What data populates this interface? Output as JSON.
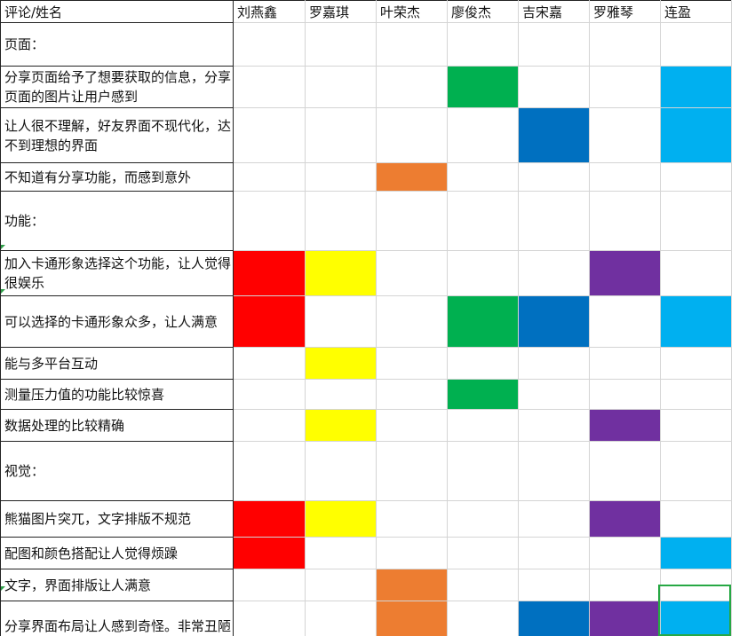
{
  "header": {
    "corner_label": "评论/姓名",
    "names": [
      "刘燕鑫",
      "罗嘉琪",
      "叶荣杰",
      "廖俊杰",
      "吉宋嘉",
      "罗雅琴",
      "连盈"
    ]
  },
  "colors": {
    "red": "#ff0000",
    "yellow": "#ffff00",
    "orange": "#ed7d31",
    "green": "#00b050",
    "blue": "#0070c0",
    "purple": "#7030a0",
    "cyan": "#00b0f0",
    "grid": "#d4d4d4",
    "selection": "#27a844"
  },
  "rows": [
    {
      "text": "页面：",
      "marks": [
        "",
        "",
        "",
        "",
        "",
        "",
        ""
      ]
    },
    {
      "text": "分享页面给予了想要获取的信息，分享页面的图片让用户感到",
      "marks": [
        "",
        "",
        "",
        "green",
        "",
        "",
        "cyan"
      ]
    },
    {
      "text": "让人很不理解，好友界面不现代化，达不到理想的界面",
      "marks": [
        "",
        "",
        "",
        "",
        "blue",
        "",
        "cyan"
      ]
    },
    {
      "text": "不知道有分享功能，而感到意外",
      "marks": [
        "",
        "",
        "orange",
        "",
        "",
        "",
        ""
      ]
    },
    {
      "text": "功能：",
      "marks": [
        "",
        "",
        "",
        "",
        "",
        "",
        ""
      ]
    },
    {
      "text": "加入卡通形象选择这个功能，让人觉得很娱乐",
      "marks": [
        "red",
        "yellow",
        "",
        "",
        "",
        "purple",
        ""
      ]
    },
    {
      "text": "可以选择的卡通形象众多，让人满意",
      "marks": [
        "red",
        "",
        "",
        "green",
        "blue",
        "",
        "cyan"
      ]
    },
    {
      "text": "能与多平台互动",
      "marks": [
        "",
        "yellow",
        "",
        "",
        "",
        "",
        ""
      ]
    },
    {
      "text": "测量压力值的功能比较惊喜",
      "marks": [
        "",
        "",
        "",
        "green",
        "",
        "",
        ""
      ]
    },
    {
      "text": "数据处理的比较精确",
      "marks": [
        "",
        "yellow",
        "",
        "",
        "",
        "purple",
        ""
      ]
    },
    {
      "text": "视觉：",
      "marks": [
        "",
        "",
        "",
        "",
        "",
        "",
        ""
      ]
    },
    {
      "text": "熊猫图片突兀，文字排版不规范",
      "marks": [
        "red",
        "yellow",
        "",
        "",
        "",
        "purple",
        ""
      ]
    },
    {
      "text": "配图和颜色搭配让人觉得烦躁",
      "marks": [
        "red",
        "",
        "",
        "",
        "",
        "",
        "cyan"
      ]
    },
    {
      "text": "文字，界面排版让人满意",
      "marks": [
        "",
        "",
        "orange",
        "",
        "",
        "",
        ""
      ]
    },
    {
      "text": "分享界面布局让人感到奇怪。非常丑陋",
      "marks": [
        "",
        "",
        "orange",
        "",
        "blue",
        "purple",
        "cyan"
      ]
    }
  ]
}
